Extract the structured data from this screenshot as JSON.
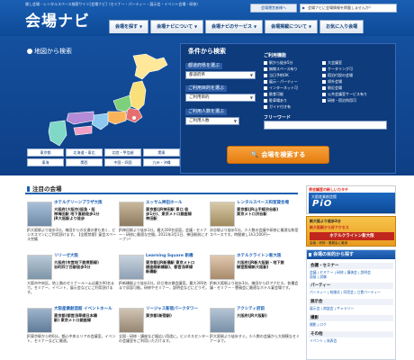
{
  "header": {
    "tagline": "貸し会場・レンタルスペース検索サイト[会場ナビ]（セミナー・パーティー・展示会・イベント会場・研修）",
    "logo_main": "会場ナビ",
    "login_label": "会場運営者様へ",
    "promo_label": "会場ナビに会場情報を掲載しませんか？"
  },
  "nav": {
    "tabs": [
      "会場を探す",
      "会場ナビについて",
      "会場ナビのサービス",
      "会場掲載について",
      "お気に入り会場"
    ]
  },
  "search": {
    "map_title": "地図から検索",
    "regions": [
      [
        "東京都",
        "北海道・東北",
        "北陸・甲信越",
        "関東"
      ],
      [
        "東海",
        "関西",
        "中国・四国",
        "九州・沖縄"
      ]
    ],
    "conditions_title": "条件から検索",
    "prefecture_label": "都道府県を選ぶ",
    "prefecture_value": "都道府県",
    "purpose_label": "ご利用目的を選ぶ",
    "purpose_value": "ご利用目的",
    "capacity_label": "ご利用人数を選ぶ",
    "capacity_value": "ご利用人数",
    "features_title": "ご利用機能",
    "features_col1": [
      "駅から徒歩5分",
      "無線スペース有り",
      "当日予約OK",
      "展示・パーティー",
      "インターネット可",
      "飲食可能",
      "駐車場あり",
      "ガイド付き有"
    ],
    "features_col2": [
      "大会議室",
      "ケータリング可",
      "宿泊付設の会場",
      "郊外会場",
      "駅近会場",
      "公共会議室サービス有り",
      "研修・宿泊利用可"
    ],
    "freeword_label": "フリーワード",
    "submit_label": "会場を検索する"
  },
  "featured": {
    "title": "注目の会場",
    "cards": [
      {
        "title": "ホテルグリーンプラザ大阪",
        "address": "大阪府(大阪市)阪急・阪\n神梅田駅 地下直結徒歩1分\nJR大阪駅より徒歩",
        "desc": "JR大阪駅より徒歩3分。梅田からの交通の便も良く、ビジネスマンにご利用頂けます。【全館禁煙】宴会スペース完備"
      },
      {
        "title": "エッサム神田ホール",
        "address": "東京都(JR神田駅 東口 徒\n歩1分)、東京メトロ銀座線\n神田駅",
        "desc": "JR神田駅より徒歩1分。最大200名収容。会議・セミナー・研修に最適な空間。2011年3月1日、神田駅前にオープン！"
      },
      {
        "title": "レンタルスペース和室貸会場",
        "address": "東京都(JR山手線渋谷駅)\n東京メトロ渋谷駅",
        "desc": "渋谷駅より徒歩5分。少人数の会議や研修に最適な和室スペースです。時間貸し1h3,500円～"
      },
      {
        "title": "リリーゼ大阪",
        "address": "大阪府(市営地下鉄堺筋線)\n谷町四丁目駅徒歩5分",
        "desc": "大阪市中央区。地上階のセミナールームは最大90名まで。セミナー、イベント、展示会などにご利用頂けます。"
      },
      {
        "title": "Learning Square 新橋",
        "address": "東京都(JR新橋駅 東京メトロ\n銀座線新橋駅)、都営浅草線\n新橋駅",
        "desc": "JR新橋駅より徒歩2分。好立地の貸会議室。最大300名まで収容可能。研修やセミナー、説明会などにどうぞ。"
      },
      {
        "title": "ホテルクライトン新大阪",
        "address": "大阪府(JR新大阪駅・地下鉄\n御堂筋線新大阪駅)",
        "desc": "JR新大阪駅より徒歩3分。梅田から好アクセス。各種会議・セミナー・懇親会に最適なホテル宴会場です。"
      },
      {
        "title": "大阪産業創造館 イベントホール",
        "address": "東京都(都営浅草線日本橋\n駅) 東京メトロ銀座線",
        "desc": "JR東京駅から約6分。都心中央エリアの会議室。イベント、セミナーなどに最適。"
      },
      {
        "title": "リージャス新宿パークタワー",
        "address": "東京都(新宿駅)",
        "desc": "全国・研修・講座など幅広い用途に。ビジネスセンターの会議室をご利用いただけます。"
      },
      {
        "title": "アクシティ府前",
        "address": "大阪府(JR大阪駅)",
        "desc": "JR大阪駅より徒歩すぐ。少人数の会議から大規模なセミナーまで。"
      }
    ]
  },
  "sidebar": {
    "banner1_top": "貸会議室の新しいカタチ",
    "banner1_sub": "大阪産業創造館",
    "banner1_brand": "PiO",
    "banner2_line1": "新大阪より徒歩3分",
    "banner2_line2": "新大阪駅から好アクセス",
    "banner2_line3": "ホテルクライトン新大阪",
    "banner2_line4": "会議・研修・懇親会に最適",
    "cat_title": "会場の目的から探す",
    "groups": [
      {
        "name": "会議・セミナー",
        "links": "会議 | セミナー | 研修 | 講演会 | 説明会\n面接 | 試験"
      },
      {
        "name": "パーティー",
        "links": "パーティー | 結婚式 | 同窓会 | 立食パーティー"
      },
      {
        "name": "展示会",
        "links": "展示会 | 商談会 | ギャラリー"
      },
      {
        "name": "撮影",
        "links": "撮影 | ロケ"
      },
      {
        "name": "その他",
        "links": "イベント | 発表会"
      }
    ]
  }
}
